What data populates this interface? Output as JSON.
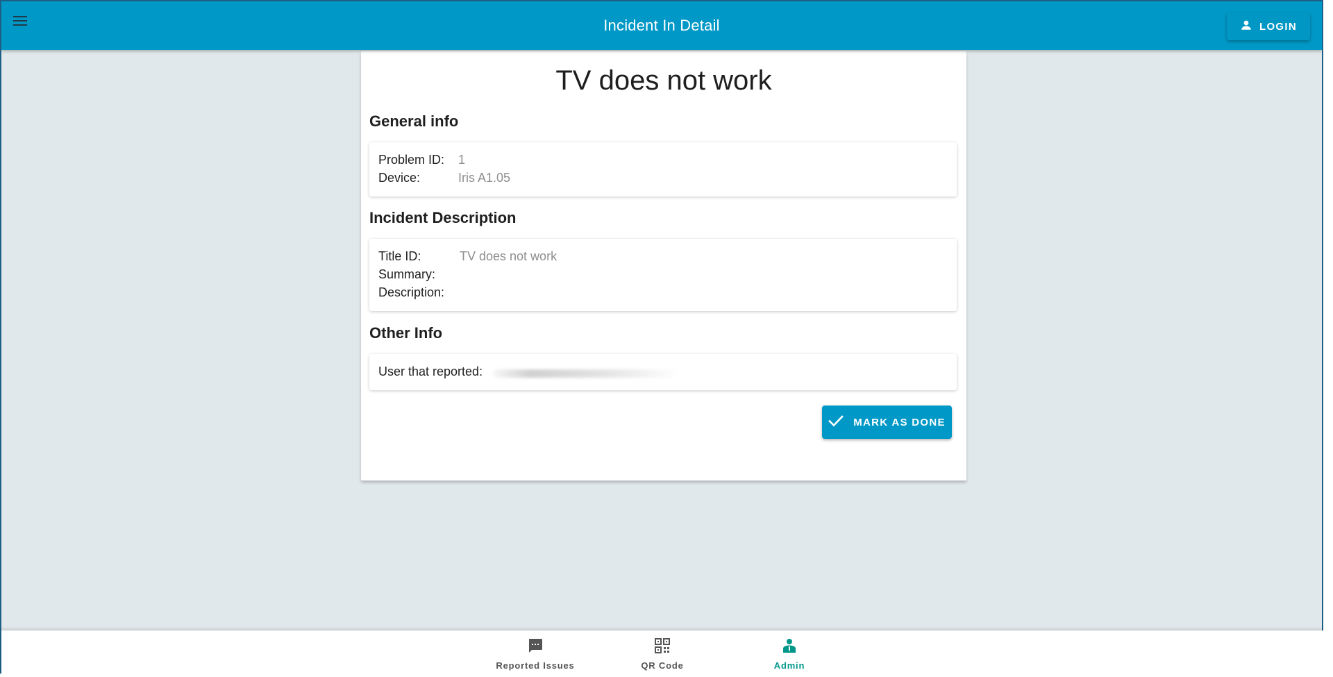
{
  "appbar": {
    "title": "Incident In Detail",
    "login_label": "LOGIN",
    "menu_icon": "menu-icon",
    "login_icon": "person-icon"
  },
  "incident": {
    "title": "TV does not work",
    "general": {
      "heading": "General info",
      "problem_id_label": "Problem ID:",
      "problem_id_value": "1",
      "device_label": "Device:",
      "device_value": "Iris A1.05"
    },
    "description": {
      "heading": "Incident Description",
      "title_id_label": "Title ID:",
      "title_id_value": "TV does not work",
      "summary_label": "Summary:",
      "summary_value": "",
      "description_label": "Description:",
      "description_value": ""
    },
    "other": {
      "heading": "Other Info",
      "user_label": "User that reported:"
    },
    "mark_done_label": "MARK AS DONE",
    "mark_done_icon": "check-icon"
  },
  "bottom_nav": {
    "items": [
      {
        "label": "Reported Issues",
        "icon": "chat-icon",
        "active": false
      },
      {
        "label": "QR Code",
        "icon": "qr-code-icon",
        "active": false
      },
      {
        "label": "Admin",
        "icon": "admin-icon",
        "active": true
      }
    ]
  },
  "colors": {
    "primary": "#0098c6",
    "background": "#e1e8eb",
    "active_nav": "#00978a"
  }
}
